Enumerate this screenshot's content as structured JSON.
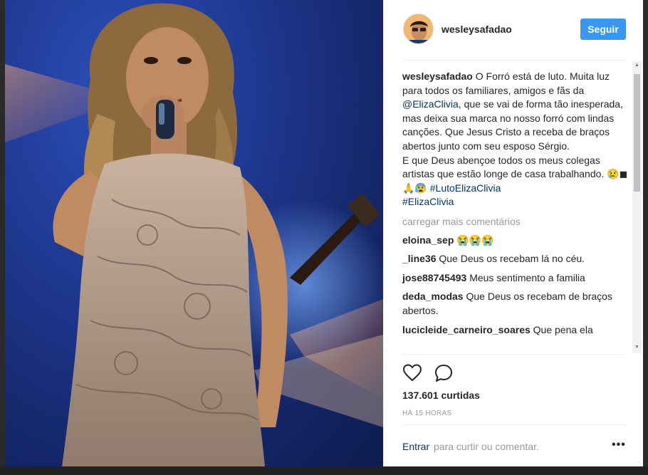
{
  "post": {
    "username": "wesleysafadao",
    "follow_label": "Seguir",
    "caption": {
      "username": "wesleysafadao",
      "text_1": " O Forró está de luto. Muita luz para todos os familiares, amigos e fãs da ",
      "mention": "@ElizaClivia",
      "text_2": ", que se vai de forma tão inesperada, mas deixa sua marca no nosso forró com lindas canções. Que Jesus Cristo a receba de braços abertos junto com seu esposo Sérgio.",
      "text_3": "E que Deus abençoe todos os meus colegas artistas que estão longe de casa trabalhando. ",
      "emoji": "😢◼🙏😰 ",
      "hashtag_1": "#LutoElizaClivia",
      "hashtag_2": "#ElizaClivia"
    },
    "load_more_label": "carregar mais comentários",
    "comments": [
      {
        "user": "eloina_sep",
        "text": " 😭😭😭"
      },
      {
        "user": "_line36",
        "text": " Que Deus os recebam lá no céu."
      },
      {
        "user": "jose88745493",
        "text": " Meus sentimento a familia"
      },
      {
        "user": "deda_modas",
        "text": " Que Deus os recebam de braços abertos."
      },
      {
        "user": "lucicleide_carneiro_soares",
        "text": " Que pena ela"
      }
    ],
    "likes_label": "137.601 curtidas",
    "time_label": "HÁ 15 HORAS",
    "enter_label": "Entrar",
    "enter_rest": "para curtir ou comentar.",
    "more_label": "•••"
  },
  "icons": {
    "heart": "heart-icon",
    "comment": "comment-bubble-icon",
    "more": "more-options-icon"
  },
  "colors": {
    "follow_button": "#3897f0",
    "link": "#003569",
    "muted": "#999999"
  }
}
